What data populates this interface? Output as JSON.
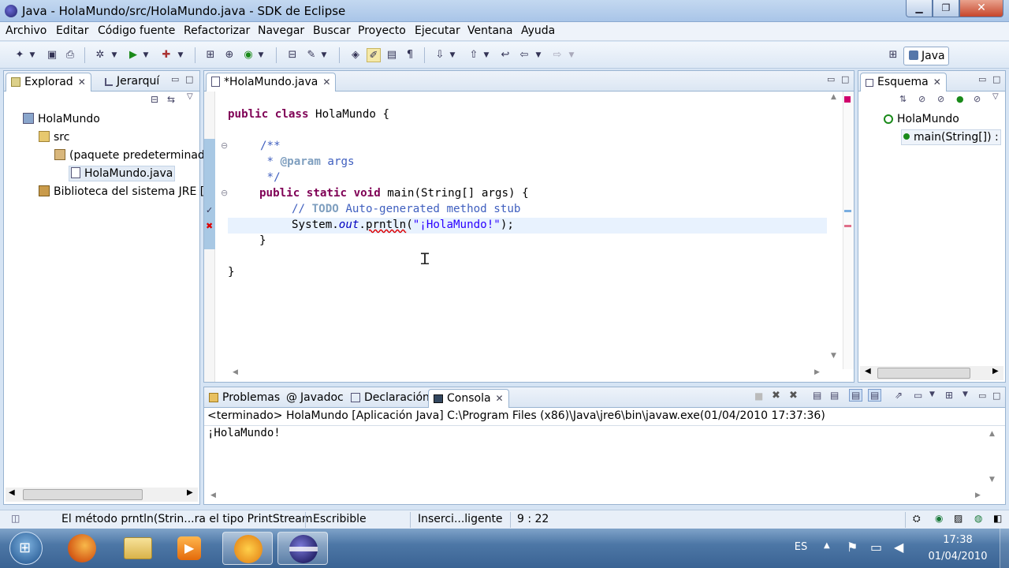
{
  "window": {
    "title": "Java - HolaMundo/src/HolaMundo.java - SDK de Eclipse",
    "min_icon": "minimize-icon",
    "max_icon": "maximize-icon",
    "close_icon": "close-icon"
  },
  "menu": [
    "Archivo",
    "Editar",
    "Código fuente",
    "Refactorizar",
    "Navegar",
    "Buscar",
    "Proyecto",
    "Ejecutar",
    "Ventana",
    "Ayuda"
  ],
  "perspective": {
    "label": "Java"
  },
  "explorer": {
    "tabs": [
      {
        "label": "Explorad"
      },
      {
        "label": "Jerarquí"
      }
    ],
    "tree": [
      {
        "label": "HolaMundo"
      },
      {
        "label": "src"
      },
      {
        "label": "(paquete predeterminad"
      },
      {
        "label": "HolaMundo.java"
      },
      {
        "label": "Biblioteca del sistema JRE ["
      }
    ]
  },
  "editor": {
    "tab_label": "*HolaMundo.java",
    "code": {
      "l1_kw1": "public",
      "l1_kw2": "class",
      "l1_rest": " HolaMundo {",
      "l2": "/**",
      "l3_star": " * ",
      "l3_tag": "@param",
      "l3_rest": " args",
      "l4": " */",
      "l5_kw1": "public",
      "l5_kw2": "static",
      "l5_kw3": "void",
      "l5_rest": " main(String[] args) {",
      "l6_pre": "// ",
      "l6_todo": "TODO",
      "l6_rest": " Auto-generated method stub",
      "l7_a": "System.",
      "l7_out": "out",
      "l7_dot": ".",
      "l7_err": "prntln",
      "l7_paren": "(",
      "l7_str": "\"¡HolaMundo!\"",
      "l7_end": ");",
      "l8": "}",
      "l9": "}"
    }
  },
  "outline": {
    "tab_label": "Esquema",
    "items": [
      {
        "label": "HolaMundo"
      },
      {
        "label": "main(String[]) :"
      }
    ]
  },
  "bottom": {
    "tabs": [
      {
        "label": "Problemas"
      },
      {
        "label": "Javadoc"
      },
      {
        "label": "Declaración"
      },
      {
        "label": "Consola"
      }
    ],
    "console_header": "<terminado> HolaMundo [Aplicación Java] C:\\Program Files (x86)\\Java\\jre6\\bin\\javaw.exe(01/04/2010 17:37:36)",
    "console_output": "¡HolaMundo!"
  },
  "status": {
    "message": "El método prntln(Strin...ra el tipo PrintStream",
    "writable": "Escribible",
    "insert_mode": "Inserci...ligente",
    "position": "9 : 22"
  },
  "taskbar": {
    "lang": "ES",
    "time": "17:38",
    "date": "01/04/2010"
  },
  "colors": {
    "keyword": "#7f0055",
    "comment": "#3f5fbf",
    "string": "#2a00ff",
    "field": "#0000c0"
  }
}
